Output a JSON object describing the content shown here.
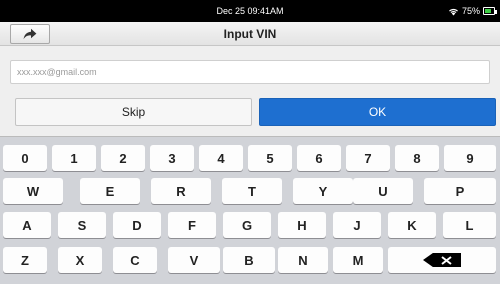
{
  "status_bar": {
    "time": "Dec 25 09:41AM",
    "battery_text": "75%",
    "battery_level": 0.75,
    "wifi_icon": "wifi-icon",
    "battery_color": "#3ecf45"
  },
  "header": {
    "title": "Input VIN",
    "back_icon": "share-arrow-icon"
  },
  "form": {
    "input_placeholder": "xxx.xxx@gmail.com",
    "input_value": ""
  },
  "buttons": {
    "skip_label": "Skip",
    "ok_label": "OK",
    "ok_color": "#1e6fd0"
  },
  "keyboard": {
    "rows": [
      [
        "0",
        "1",
        "2",
        "3",
        "4",
        "5",
        "6",
        "7",
        "8",
        "9"
      ],
      [
        "W",
        "E",
        "R",
        "T",
        "Y",
        "U",
        "P"
      ],
      [
        "A",
        "S",
        "D",
        "F",
        "G",
        "H",
        "J",
        "K",
        "L"
      ],
      [
        "Z",
        "X",
        "C",
        "V",
        "B",
        "N",
        "M"
      ]
    ],
    "backspace_icon": "backspace-icon"
  }
}
